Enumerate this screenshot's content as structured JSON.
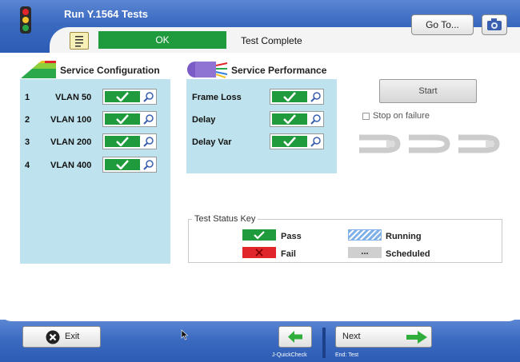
{
  "header": {
    "title": "Run Y.1564 Tests",
    "status_indicator": "OK",
    "status_text": "Test Complete",
    "goto_label": "Go To..."
  },
  "service_configuration": {
    "title": "Service Configuration",
    "rows": [
      {
        "index": "1",
        "label": "VLAN 50",
        "status": "pass"
      },
      {
        "index": "2",
        "label": "VLAN 100",
        "status": "pass"
      },
      {
        "index": "3",
        "label": "VLAN 200",
        "status": "pass"
      },
      {
        "index": "4",
        "label": "VLAN 400",
        "status": "pass"
      }
    ]
  },
  "service_performance": {
    "title": "Service Performance",
    "rows": [
      {
        "label": "Frame Loss",
        "status": "pass"
      },
      {
        "label": "Delay",
        "status": "pass"
      },
      {
        "label": "Delay Var",
        "status": "pass"
      }
    ]
  },
  "controls": {
    "start_label": "Start",
    "stop_on_failure_label": "Stop on failure",
    "stop_on_failure_checked": false
  },
  "status_key": {
    "title": "Test Status Key",
    "items": [
      {
        "label": "Pass",
        "color": "#1f9b3d"
      },
      {
        "label": "Running",
        "color": "#7fb0e8"
      },
      {
        "label": "Fail",
        "color": "#e0262b"
      },
      {
        "label": "Scheduled",
        "color": "#cfcfcf",
        "symbol": "..."
      }
    ]
  },
  "footer": {
    "exit_label": "Exit",
    "back_sub": "J-QuickCheck",
    "next_label": "Next",
    "next_sub": "End: Test"
  },
  "colors": {
    "header_blue": "#3a69c0",
    "panel_bg": "#bfe3ee",
    "pass_green": "#1f9b3d",
    "fail_red": "#e0262b"
  },
  "icons": {
    "traffic_light": "traffic-light-icon",
    "notes": "notes-icon",
    "camera": "camera-icon",
    "magnifier": "magnifier-icon",
    "check": "check-icon",
    "loop": "loopback-icon",
    "arrow_left": "arrow-left-icon",
    "arrow_right": "arrow-right-icon",
    "exit": "exit-x-icon"
  }
}
